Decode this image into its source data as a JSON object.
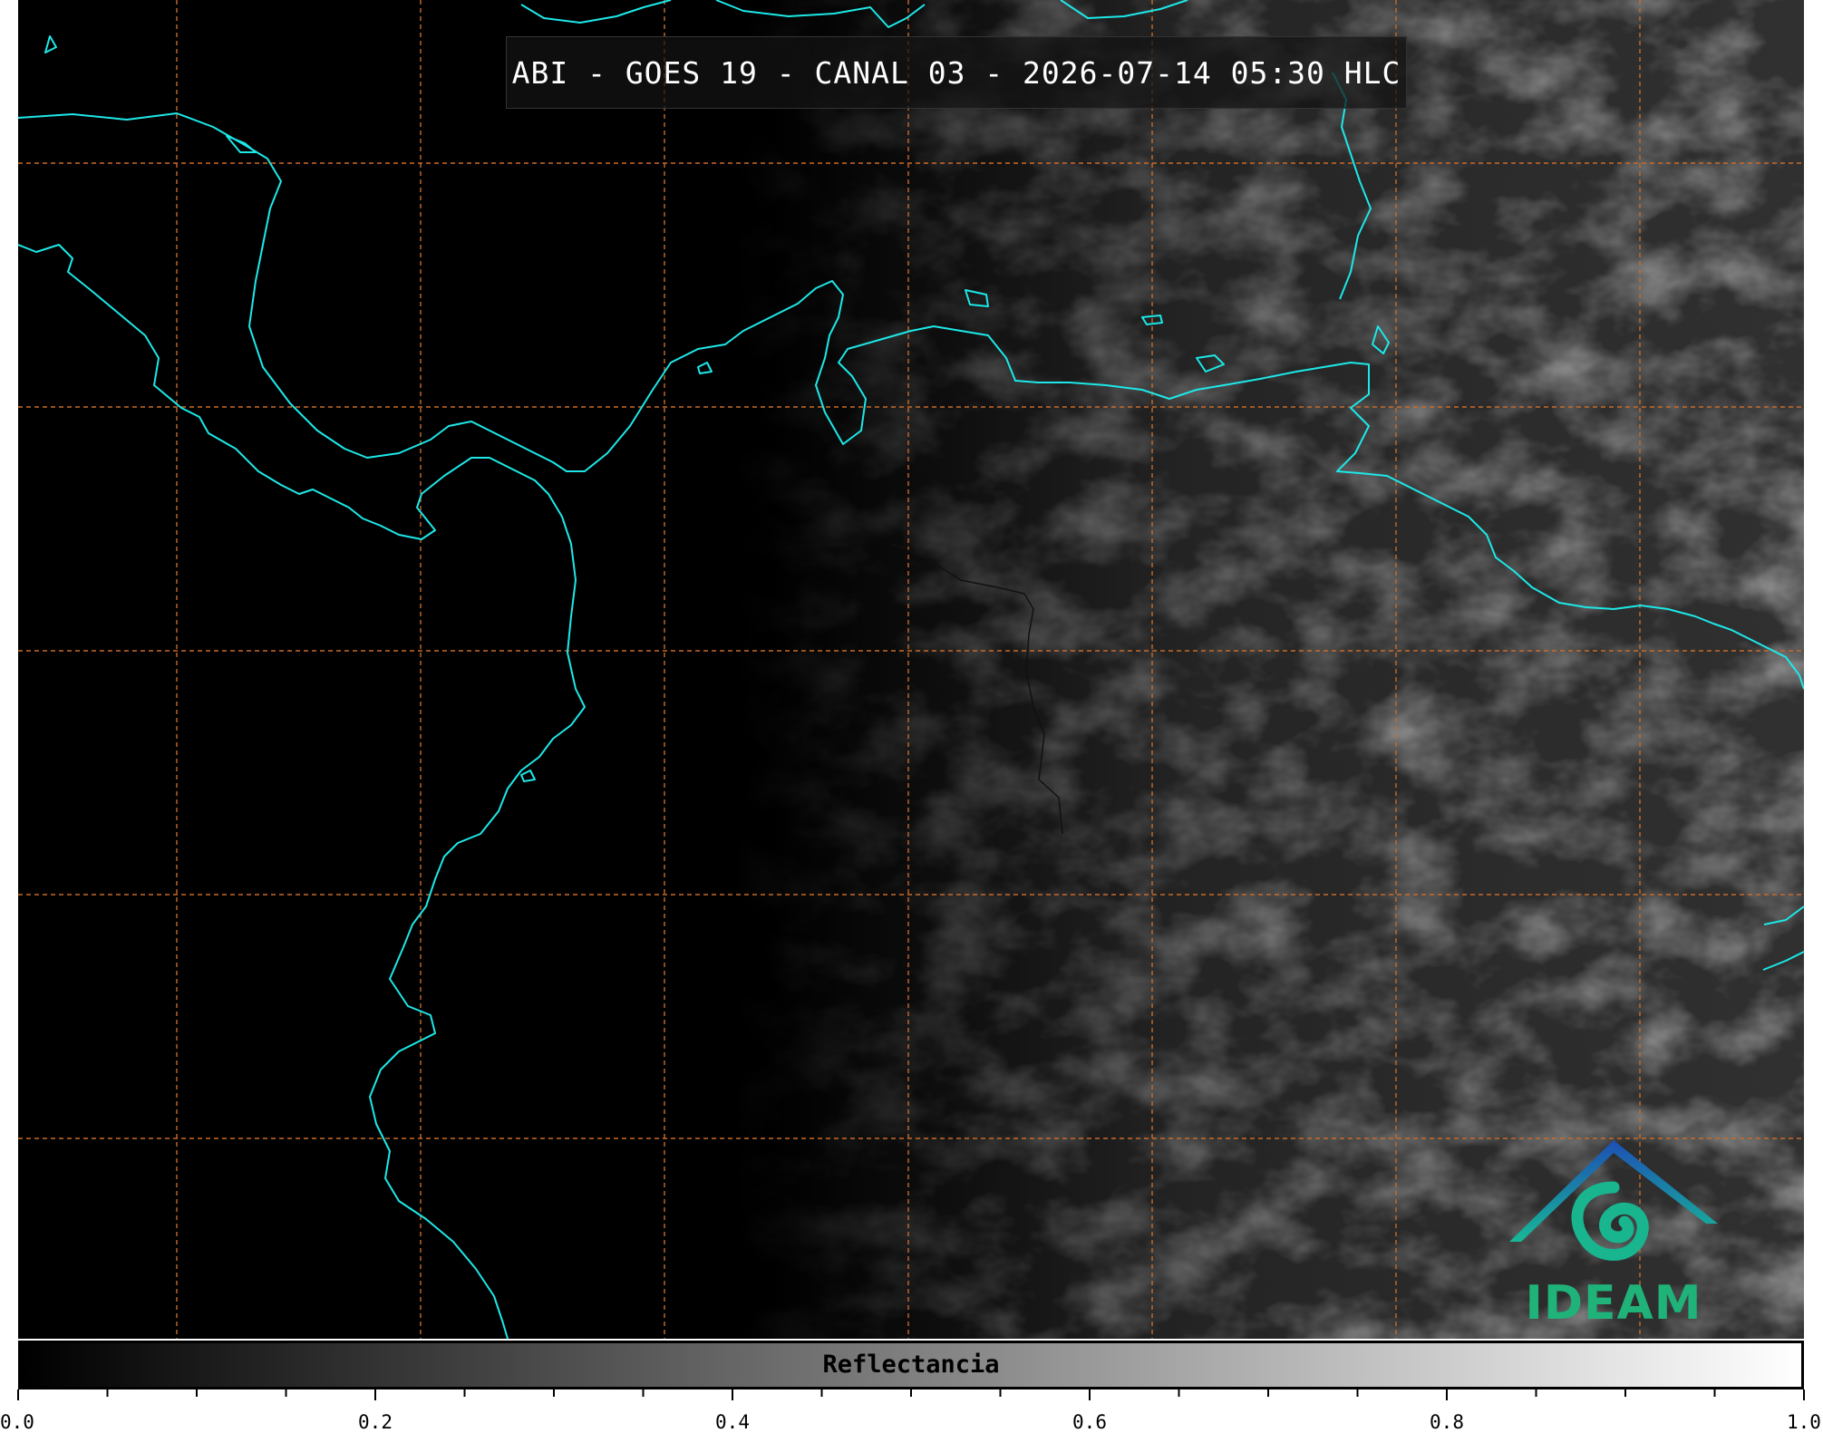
{
  "map": {
    "title": "ABI - GOES 19 - CANAL 03 - 2026-07-14 05:30 HLC",
    "colors": {
      "coastline": "#1ee8e8",
      "gridline": "#c96a2a",
      "border": "#111111"
    },
    "icons": [
      "ideam-logo-icon"
    ]
  },
  "logo": {
    "text": "IDEAM"
  },
  "colorbar": {
    "label": "Reflectancia",
    "range": [
      0.0,
      1.0
    ],
    "major_ticks": [
      "0.0",
      "0.2",
      "0.4",
      "0.6",
      "0.8",
      "1.0"
    ],
    "colors": {
      "low": "#000000",
      "high": "#ffffff"
    }
  }
}
